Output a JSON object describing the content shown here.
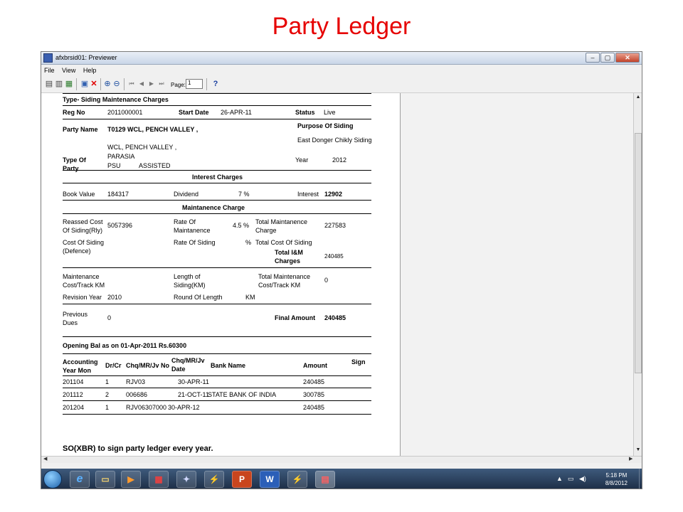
{
  "slide": {
    "title": "Party Ledger"
  },
  "window": {
    "title": "afxbrsid01: Previewer",
    "min": "–",
    "max": "▢",
    "close": "✕"
  },
  "menu": [
    "File",
    "View",
    "Help"
  ],
  "toolbar": {
    "page_label": "Page:",
    "page_value": "1",
    "help": "?"
  },
  "report": {
    "type_line": "Type- Siding Maintenance Charges",
    "reg_no_label": "Reg No",
    "reg_no": "2011000001",
    "start_date_label": "Start Date",
    "start_date": "26-APR-11",
    "status_label": "Status",
    "status": "Live",
    "party_name_label": "Party Name",
    "party_name": "T0129   WCL, PENCH VALLEY ,",
    "purpose_label": "Purpose Of Siding",
    "purpose": "East Donger Chikly Siding",
    "address1": "WCL, PENCH VALLEY ,",
    "address2": "PARASIA",
    "type_of_party_label1": "Type Of",
    "type_of_party_label2": "Party",
    "party_type1": "PSU",
    "party_type2": "ASSISTED",
    "year_label": "Year",
    "year": "2012",
    "interest_charges_heading": "Interest Charges",
    "book_value_label": "Book Value",
    "book_value": "184317",
    "dividend_label": "Dividend",
    "dividend": "7  %",
    "interest_label": "Interest",
    "interest": "12902",
    "maintenance_heading": "Maintanence Charge",
    "reassed_label1": "Reassed Cost",
    "reassed_label2": "Of Siding(Rly)",
    "reassed": "5057396",
    "rate_label1": "Rate Of",
    "rate_label2": "Maintanence",
    "rate": "4.5  %",
    "total_maint_label1": "Total Maintanence",
    "total_maint_label2": "Charge",
    "total_maint": "227583",
    "cost_def_label1": "Cost Of Siding",
    "cost_def_label2": "(Defence)",
    "rate_siding_label": "Rate Of Siding",
    "rate_siding": "%",
    "total_cost_label": "Total Cost Of Siding",
    "total_im_label1": "Total I&M",
    "total_im_label2": "Charges",
    "total_im": "240485",
    "maint_cost_label1": "Maintenance",
    "maint_cost_label2": "Cost/Track KM",
    "length_label1": "Length of",
    "length_label2": "Siding(KM)",
    "total_mct_label1": "Total Maintenance",
    "total_mct_label2": "Cost/Track KM",
    "total_mct": "0",
    "revision_year_label": "Revision Year",
    "revision_year": "2010",
    "round_length_label": "Round Of Length",
    "round_length_unit": "KM",
    "prev_dues_label1": "Previous",
    "prev_dues_label2": "Dues",
    "prev_dues": "0",
    "final_amount_label": "Final Amount",
    "final_amount": "240485",
    "opening_bal": "Opening Bal as on 01-Apr-2011 Rs.60300",
    "table_headers": {
      "acc_year1": "Accounting",
      "acc_year2": "Year Mon",
      "drcr": "Dr/Cr",
      "chq": "Chq/MR/Jv No",
      "chq_date1": "Chq/MR/Jv",
      "chq_date2": "Date",
      "bank": "Bank Name",
      "amount": "Amount",
      "sign": "Sign"
    },
    "rows": [
      {
        "acc": "201104",
        "drcr": "1",
        "chq": "RJV03",
        "date": "30-APR-11",
        "bank": "",
        "amount": "240485"
      },
      {
        "acc": "201112",
        "drcr": "2",
        "chq": "006686",
        "date": "21-OCT-11",
        "bank": "STATE BANK OF INDIA",
        "amount": "300785"
      },
      {
        "acc": "201204",
        "drcr": "1",
        "chq": "RJV06307000",
        "date": "30-APR-12",
        "bank": "",
        "amount": "240485"
      }
    ],
    "footer_note": "SO(XBR) to sign party ledger every year."
  },
  "taskbar": {
    "time": "5:18 PM",
    "date": "8/8/2012",
    "ie_glyph": "e",
    "ppt_glyph": "P",
    "word_glyph": "W"
  }
}
